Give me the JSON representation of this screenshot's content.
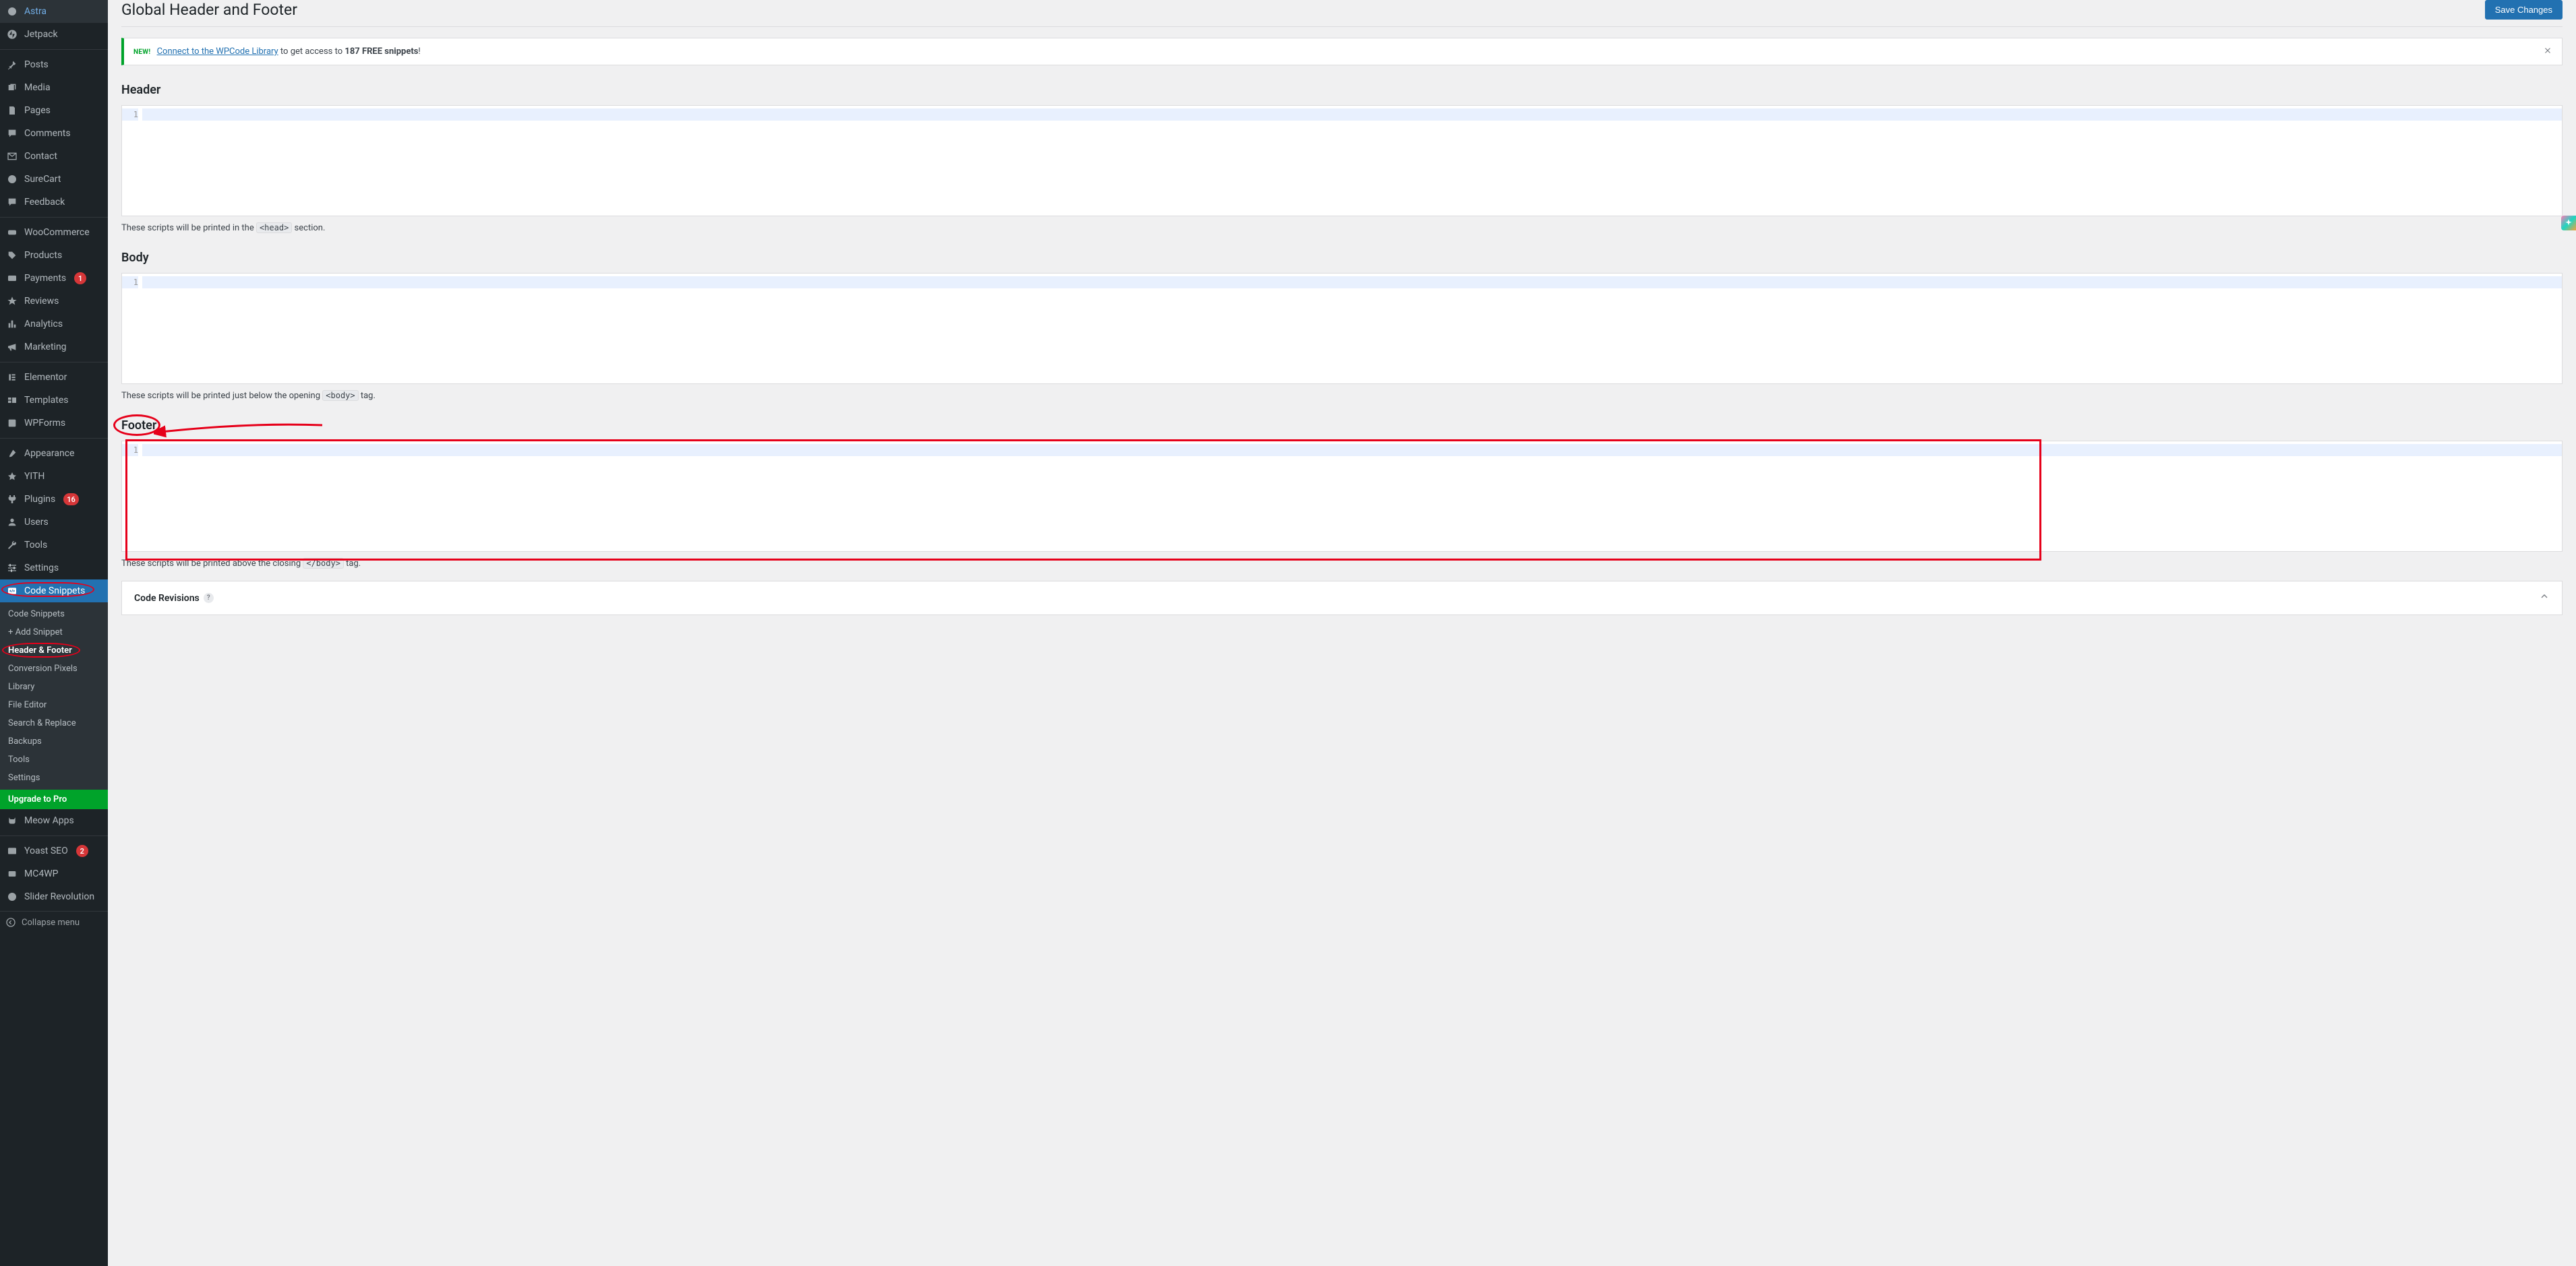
{
  "sidebar": {
    "items": [
      {
        "label": "Astra"
      },
      {
        "label": "Jetpack"
      },
      {
        "label": "Posts"
      },
      {
        "label": "Media"
      },
      {
        "label": "Pages"
      },
      {
        "label": "Comments"
      },
      {
        "label": "Contact"
      },
      {
        "label": "SureCart"
      },
      {
        "label": "Feedback"
      },
      {
        "label": "WooCommerce"
      },
      {
        "label": "Products"
      },
      {
        "label": "Payments",
        "badge": "1"
      },
      {
        "label": "Reviews"
      },
      {
        "label": "Analytics"
      },
      {
        "label": "Marketing"
      },
      {
        "label": "Elementor"
      },
      {
        "label": "Templates"
      },
      {
        "label": "WPForms"
      },
      {
        "label": "Appearance"
      },
      {
        "label": "YITH"
      },
      {
        "label": "Plugins",
        "badge": "16"
      },
      {
        "label": "Users"
      },
      {
        "label": "Tools"
      },
      {
        "label": "Settings"
      },
      {
        "label": "Code Snippets"
      }
    ],
    "submenu": [
      {
        "label": "Code Snippets"
      },
      {
        "label": "+ Add Snippet"
      },
      {
        "label": "Header & Footer"
      },
      {
        "label": "Conversion Pixels"
      },
      {
        "label": "Library"
      },
      {
        "label": "File Editor"
      },
      {
        "label": "Search & Replace"
      },
      {
        "label": "Backups"
      },
      {
        "label": "Tools"
      },
      {
        "label": "Settings"
      }
    ],
    "upgrade": "Upgrade to Pro",
    "after_items": [
      {
        "label": "Meow Apps"
      },
      {
        "label": "Yoast SEO",
        "badge": "2"
      },
      {
        "label": "MC4WP"
      },
      {
        "label": "Slider Revolution"
      }
    ],
    "collapse": "Collapse menu"
  },
  "header": {
    "title": "Global Header and Footer",
    "save_button": "Save Changes"
  },
  "notice": {
    "new_label": "NEW!",
    "link_text": "Connect to the WPCode Library",
    "text_before": " to get access to ",
    "bold_part": "187 FREE snippets",
    "text_after": "!"
  },
  "sections": {
    "header": {
      "title": "Header",
      "line": "1",
      "hint_before": "These scripts will be printed in the ",
      "hint_code": "<head>",
      "hint_after": " section."
    },
    "body": {
      "title": "Body",
      "line": "1",
      "hint_before": "These scripts will be printed just below the opening ",
      "hint_code": "<body>",
      "hint_after": " tag."
    },
    "footer": {
      "title": "Footer",
      "line": "1",
      "hint_before": "These scripts will be printed above the closing ",
      "hint_code": "</body>",
      "hint_after": " tag."
    }
  },
  "revisions": {
    "title": "Code Revisions"
  }
}
